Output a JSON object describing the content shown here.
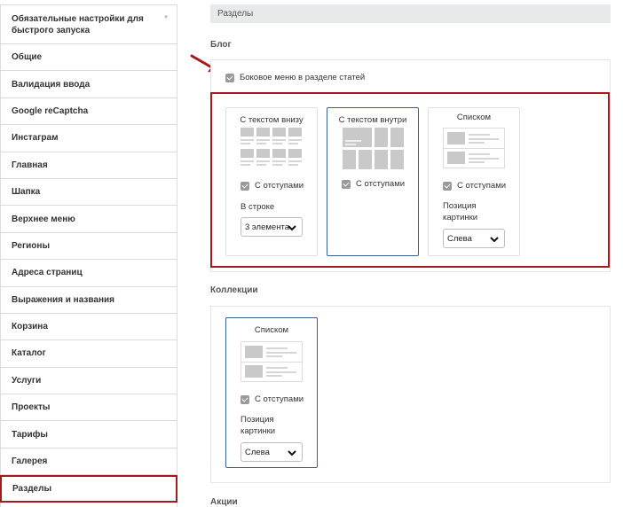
{
  "sidebar": {
    "items": [
      "Обязательные настройки для быстрого запуска",
      "Общие",
      "Валидация ввода",
      "Google reCaptcha",
      "Инстаграм",
      "Главная",
      "Шапка",
      "Верхнее меню",
      "Регионы",
      "Адреса страниц",
      "Выражения и названия",
      "Корзина",
      "Каталог",
      "Услуги",
      "Проекты",
      "Тарифы",
      "Галерея",
      "Разделы"
    ],
    "star": "*",
    "active_index": 17
  },
  "main": {
    "section_title": "Разделы",
    "blog": {
      "title": "Блог",
      "side_menu_label": "Боковое меню в разделе статей",
      "cards": [
        {
          "title": "С текстом внизу",
          "checkbox_label": "С отступами",
          "field_label": "В строке",
          "select_value": "3 элемента"
        },
        {
          "title": "С текстом внутри",
          "checkbox_label": "С отступами"
        },
        {
          "title": "Списком",
          "checkbox_label": "С отступами",
          "field_label": "Позиция картинки",
          "select_value": "Слева"
        }
      ]
    },
    "collections": {
      "title": "Коллекции",
      "card": {
        "title": "Списком",
        "checkbox_label": "С отступами",
        "field_label": "Позиция картинки",
        "select_value": "Слева"
      }
    },
    "promos": {
      "title": "Акции"
    }
  },
  "colors": {
    "highlight": "#a6191e",
    "selected_border": "#3c5f8f",
    "header_bg": "#e8e9ea"
  }
}
